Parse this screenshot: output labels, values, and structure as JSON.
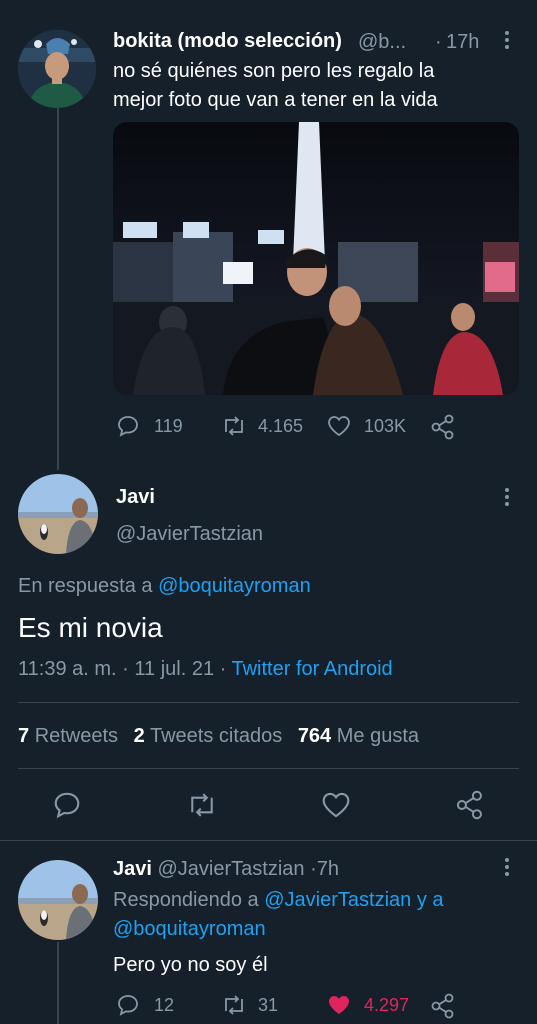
{
  "tweet1": {
    "name": "bokita (modo selección)",
    "handle": "@b...",
    "sep": "·",
    "time": "17h",
    "text_line1": "no sé quiénes son pero les regalo la",
    "text_line2": "mejor foto que van a tener en la vida",
    "replies": "119",
    "retweets": "4.165",
    "likes": "103K"
  },
  "main_tweet": {
    "name": "Javi",
    "handle": "@JavierTastzian",
    "reply_prefix": "En respuesta a",
    "reply_to": "@boquitayroman",
    "text": "Es mi novia",
    "time": "11:39 a. m.",
    "date": "11 jul. 21",
    "sep": "·",
    "source": "Twitter for Android",
    "retweets_count": "7",
    "retweets_label": "Retweets",
    "quotes_count": "2",
    "quotes_label": "Tweets citados",
    "likes_count": "764",
    "likes_label": "Me gusta"
  },
  "tweet3": {
    "name": "Javi",
    "handle": "@JavierTastzian",
    "sep": "·",
    "time": "7h",
    "replying_prefix": "Respondiendo a",
    "replying_to": "@JavierTastzian y a",
    "replying_to2": "@boquitayroman",
    "text": "Pero yo no soy él",
    "replies": "12",
    "retweets": "31",
    "likes": "4.297"
  },
  "colors": {
    "background": "#15202b",
    "accent": "#1da1f2",
    "muted": "#8899a6",
    "like": "#e0245e"
  }
}
